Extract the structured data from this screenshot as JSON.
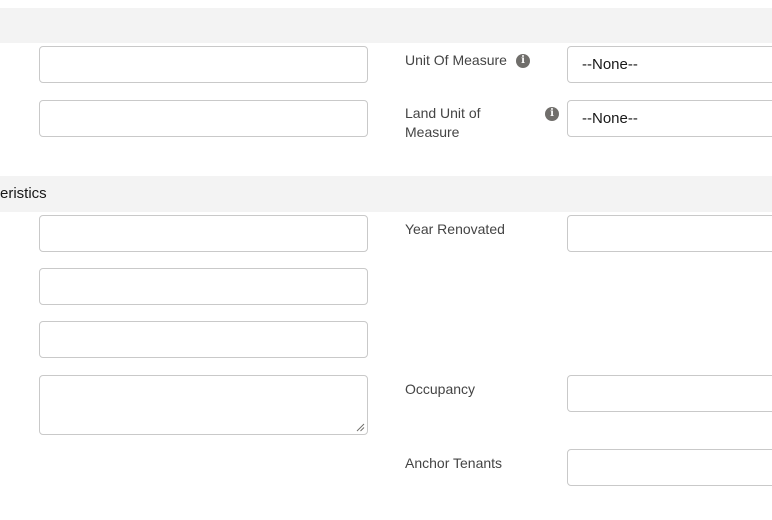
{
  "sections": {
    "top": {
      "title": ""
    },
    "characteristics": {
      "title": "eristics"
    }
  },
  "fields": {
    "unit_of_measure": {
      "label": "Unit Of Measure",
      "value": "--None--",
      "icon": "info-icon"
    },
    "land_unit_of_measure": {
      "label_line1": "Land Unit of",
      "label_line2": "Measure",
      "value": "--None--",
      "icon": "info-icon"
    },
    "year_renovated": {
      "label": "Year Renovated",
      "value": ""
    },
    "occupancy": {
      "label": "Occupancy",
      "value": ""
    },
    "anchor_tenants": {
      "label": "Anchor Tenants",
      "value": ""
    }
  },
  "icons": {
    "info": "i"
  },
  "colors": {
    "section_bg": "#f3f3f3",
    "border": "#c9c9c9",
    "label": "#444444",
    "icon": "#706e6b"
  }
}
